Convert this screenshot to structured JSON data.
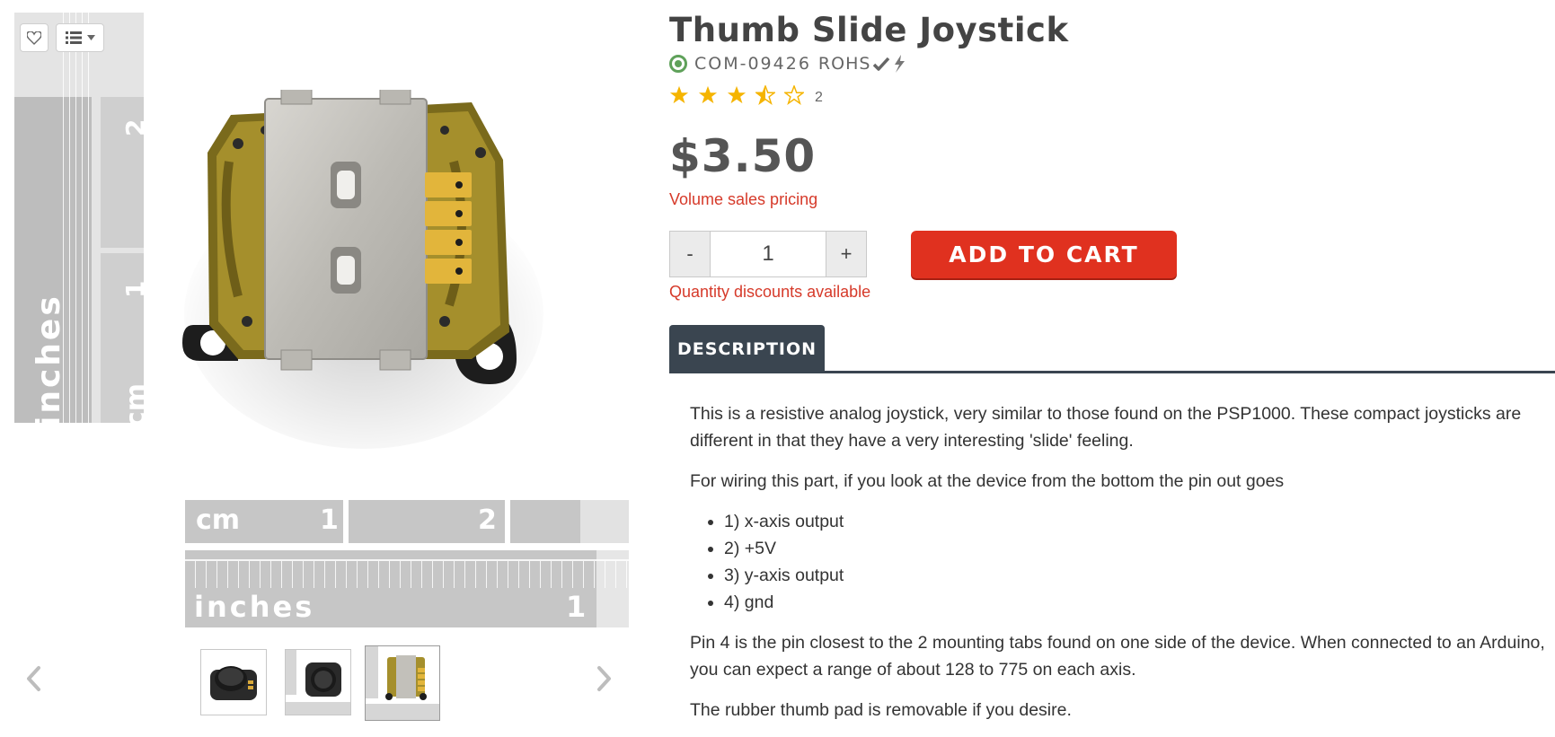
{
  "gallery": {
    "icons": {
      "wishlist": "heart-icon",
      "list": "list-icon",
      "prev": "chevron-left-icon",
      "next": "chevron-right-icon"
    },
    "ruler_vertical": {
      "inches_label": "inches",
      "cm_label": "cm",
      "mark_1": "1",
      "mark_2": "2"
    },
    "ruler_horizontal": {
      "cm_label": "cm",
      "mark_1": "1",
      "mark_2": "2",
      "inches_label": "inches",
      "inch_mark_1": "1"
    },
    "thumbnails": [
      {
        "alt": "joystick with black cap"
      },
      {
        "alt": "joystick on ruler"
      },
      {
        "alt": "joystick back on ruler"
      }
    ],
    "selected_thumbnail": 3
  },
  "product": {
    "title": "Thumb Slide Joystick",
    "sku": "COM-09426",
    "rohs": "ROHS",
    "rating": 3.5,
    "rating_max": 5,
    "review_count": "2",
    "price": "$3.50",
    "volume_pricing": "Volume sales pricing",
    "quantity": "1",
    "qty_minus": "-",
    "qty_plus": "+",
    "quantity_discounts": "Quantity discounts available",
    "add_to_cart": "ADD TO CART",
    "colors": {
      "accent": "#e0311f",
      "link": "#d63a2a",
      "status": "#5fa15a",
      "star": "#f5b400",
      "tab": "#3a4550"
    }
  },
  "tabs": [
    {
      "label": "DESCRIPTION",
      "active": true
    }
  ],
  "description": {
    "para1": "This is a resistive analog joystick, very similar to those found on the PSP1000. These compact joysticks are different in that they have a very interesting 'slide' feeling.",
    "para2": "For wiring this part, if you look at the device from the bottom the pin out goes",
    "pins": [
      "1) x-axis output",
      "2) +5V",
      "3) y-axis output",
      "4) gnd"
    ],
    "para3": "Pin 4 is the pin closest to the 2 mounting tabs found on one side of the device. When connected to an Arduino, you can expect a range of about 128 to 775 on each axis.",
    "para4": "The rubber thumb pad is removable if you desire."
  }
}
